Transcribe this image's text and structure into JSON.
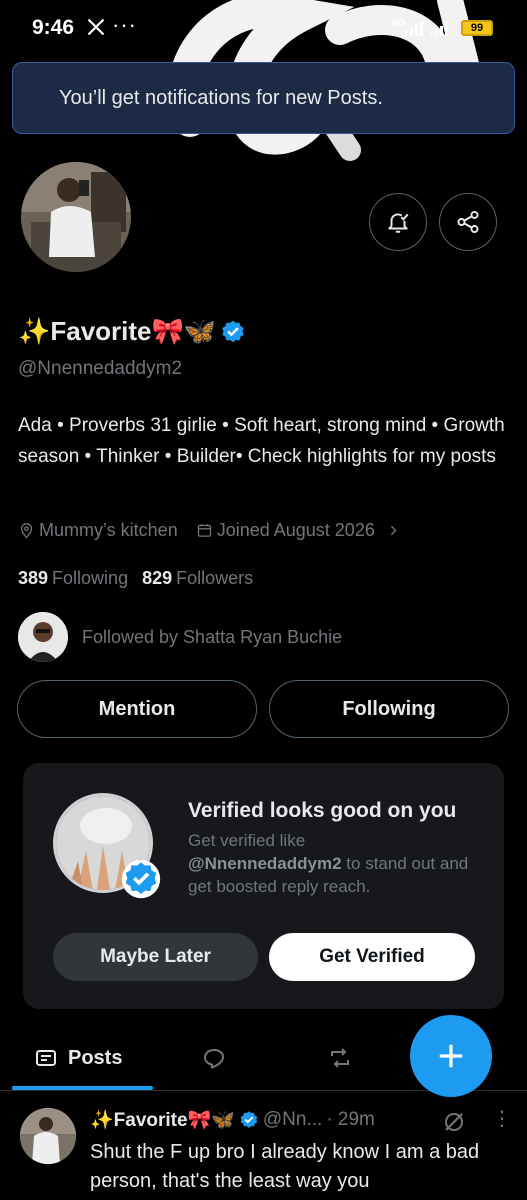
{
  "status_bar": {
    "time": "9:46",
    "more": "···",
    "network": "4G",
    "battery": "99"
  },
  "toast": {
    "text": "You’ll get notifications for new Posts."
  },
  "profile": {
    "display_name": "✨Favorite🎀🦋",
    "handle": "@Nnennedaddym2",
    "bio": "Ada • Proverbs 31 girlie • Soft heart, strong mind • Growth season • Thinker • Builder• Check highlights for my posts",
    "location": "Mummy’s kitchen",
    "joined": "Joined August 2026",
    "following_count": "389",
    "following_label": "Following",
    "followers_count": "829",
    "followers_label": "Followers",
    "followed_by": "Followed by Shatta Ryan Buchie"
  },
  "actions": {
    "mention": "Mention",
    "following": "Following"
  },
  "verify_card": {
    "title": "Verified looks good on you",
    "desc_prefix": "Get verified like",
    "desc_handle": "@Nnennedaddym2",
    "desc_suffix": "to stand out and get boosted reply reach.",
    "maybe_later": "Maybe Later",
    "get_verified": "Get Verified"
  },
  "tabs": {
    "posts": "Posts"
  },
  "post": {
    "name": "✨Favorite🎀🦋",
    "handle": "@Nn...",
    "time": "· 29m",
    "more": "⋮",
    "text": "Shut the F up bro I already know I am a bad person, that's the least way you"
  },
  "colors": {
    "accent": "#1d9bf0",
    "toast_bg": "#1d2a45",
    "card_bg": "#16181c",
    "battery": "#f5c518"
  }
}
